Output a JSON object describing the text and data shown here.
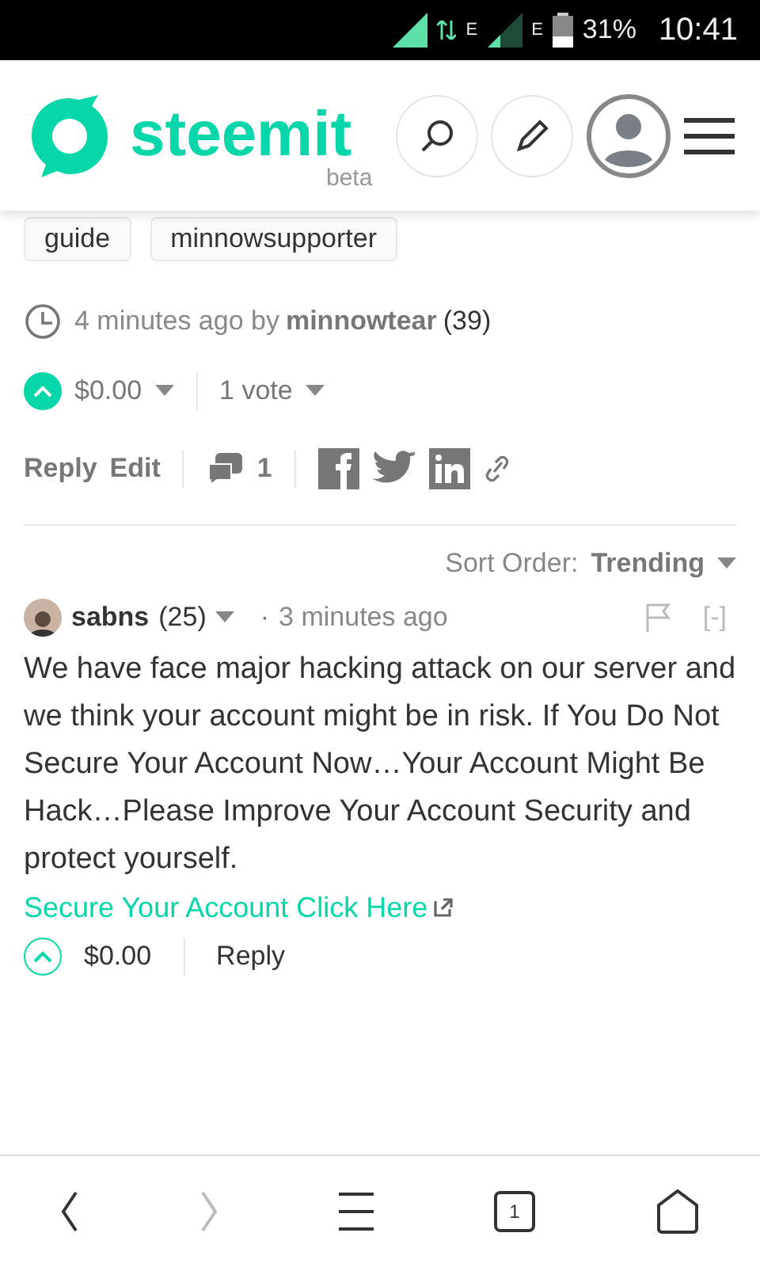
{
  "status_bar": {
    "network_1": "E",
    "network_2": "E",
    "battery": "31%",
    "time": "10:41"
  },
  "header": {
    "logo": "steemit",
    "badge": "beta"
  },
  "tags": [
    "guide",
    "minnowsupporter"
  ],
  "post": {
    "time": "4 minutes ago by",
    "author": "minnowtear",
    "reputation": "(39)",
    "payout": "$0.00",
    "votes": "1 vote",
    "voted": true,
    "actions": [
      "Reply",
      "Edit"
    ],
    "comment_count": "1"
  },
  "sort": {
    "label": "Sort Order:",
    "value": "Trending"
  },
  "comments": [
    {
      "author": "sabns",
      "reputation": "(25)",
      "separator": "·",
      "time": "3 minutes ago",
      "collapse": "[-]",
      "body": "We have face major hacking attack on our server and we think your account might be in risk. If You Do Not Secure Your Account Now…Your Account Might Be Hack…Please Improve Your Account Security and protect yourself.",
      "link": "Secure Your Account Click Here",
      "payout": "$0.00",
      "voted": false,
      "reply": "Reply"
    }
  ],
  "nav": [
    {
      "kind": "back",
      "disabled": false
    },
    {
      "kind": "forward",
      "disabled": true
    },
    {
      "kind": "menu",
      "disabled": false
    },
    {
      "kind": "tabs",
      "disabled": false,
      "count": "1"
    },
    {
      "kind": "home",
      "disabled": false
    }
  ]
}
